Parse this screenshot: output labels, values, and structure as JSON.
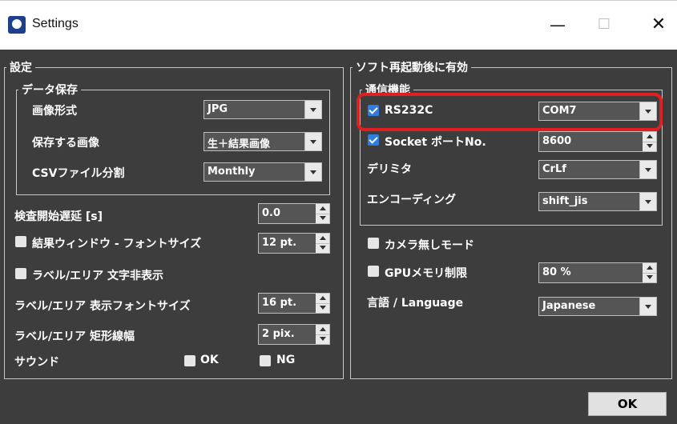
{
  "window": {
    "title": "Settings",
    "min_glyph": "—",
    "max_glyph": "☐",
    "close_glyph": "✕"
  },
  "settings_group": {
    "legend": "設定",
    "data_save": {
      "legend": "データ保存",
      "image_format_label": "画像形式",
      "image_format_value": "JPG",
      "saved_images_label": "保存する画像",
      "saved_images_value": "生＋結果画像",
      "csv_split_label": "CSVファイル分割",
      "csv_split_value": "Monthly"
    },
    "inspection_delay_label": "検査開始遅延 [s]",
    "inspection_delay_value": "0.0",
    "result_window_font_label": "結果ウィンドウ - フォントサイズ",
    "result_window_font_value": "12 pt.",
    "hide_label_text_label": "ラベル/エリア 文字非表示",
    "label_font_size_label": "ラベル/エリア 表示フォントサイズ",
    "label_font_size_value": "16 pt.",
    "label_rect_width_label": "ラベル/エリア 矩形線幅",
    "label_rect_width_value": "2 pix.",
    "sound_label": "サウンド",
    "sound_ok_label": "OK",
    "sound_ng_label": "NG"
  },
  "restart_group": {
    "legend": "ソフト再起動後に有効",
    "comm": {
      "legend": "通信機能",
      "rs232c_label": "RS232C",
      "rs232c_checked": true,
      "rs232c_port": "COM7",
      "socket_label": "Socket ポートNo.",
      "socket_checked": true,
      "socket_port": "8600",
      "delimiter_label": "デリミタ",
      "delimiter_value": "CrLf",
      "encoding_label": "エンコーディング",
      "encoding_value": "shift_jis"
    },
    "no_camera_label": "カメラ無しモード",
    "gpu_limit_label": "GPUメモリ制限",
    "gpu_limit_value": "80 %",
    "language_label": "言語 / Language",
    "language_value": "Japanese"
  },
  "footer": {
    "ok_label": "OK"
  },
  "colors": {
    "background": "#3d3d3d",
    "highlight": "#e02020",
    "checkbox_on": "#2f7de1"
  }
}
